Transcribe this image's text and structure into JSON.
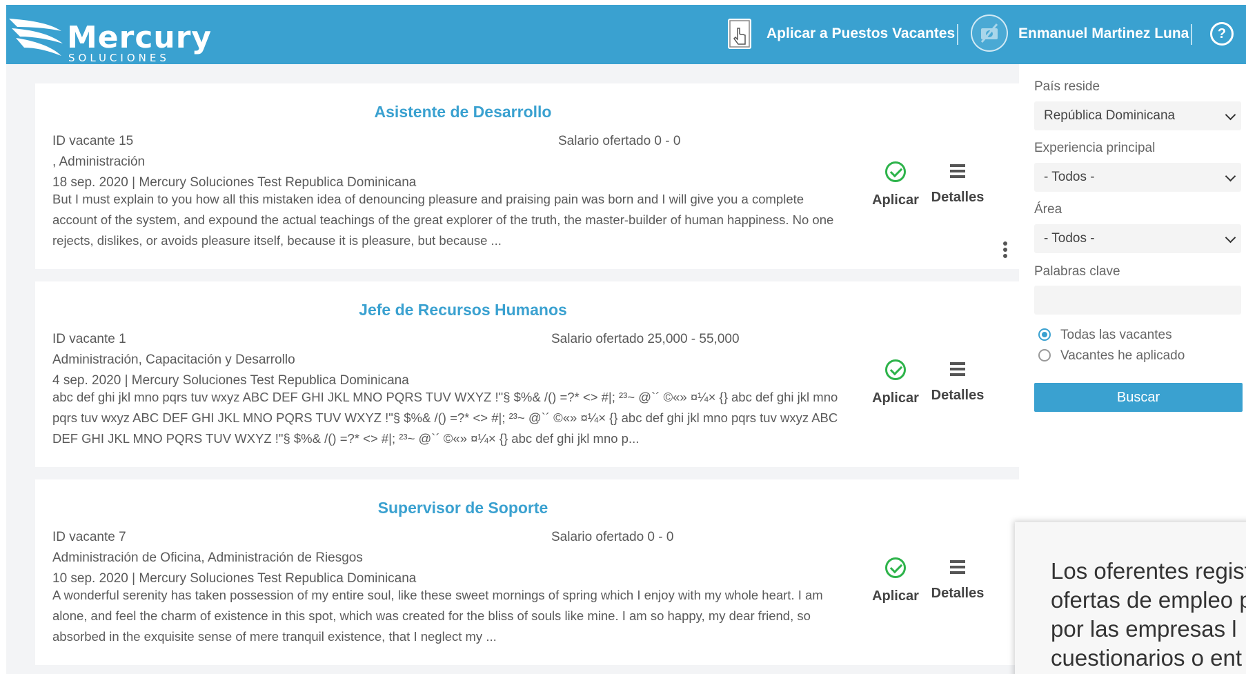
{
  "header": {
    "brand": "Mercury",
    "brand_sub": "SOLUCIONES",
    "apply_link": "Aplicar a Puestos Vacantes",
    "user_name": "Enmanuel Martinez Luna",
    "help_symbol": "?",
    "colors": {
      "primary": "#3aa1d0",
      "success": "#2db34a"
    }
  },
  "jobs": [
    {
      "title": "Asistente de Desarrollo",
      "id_text": "ID vacante  15",
      "salary_text": "Salario ofertado   0 - 0",
      "areas": ", Administración",
      "meta": "18 sep. 2020 | Mercury Soluciones Test Republica Dominicana",
      "description": "But I must explain to you how all this mistaken idea of denouncing pleasure and praising pain was born and I will give you a complete account of the system, and expound the actual teachings of the great explorer of the truth, the master-builder of human happiness. No one rejects, dislikes, or avoids pleasure itself, because it is pleasure, but because ...",
      "apply_label": "Aplicar",
      "details_label": "Detalles"
    },
    {
      "title": "Jefe de Recursos Humanos",
      "id_text": "ID vacante  1",
      "salary_text": "Salario ofertado   25,000 - 55,000",
      "areas": "Administración, Capacitación y Desarrollo",
      "meta": "4 sep. 2020 | Mercury Soluciones Test Republica Dominicana",
      "description": "abc def ghi jkl mno pqrs tuv wxyz ABC DEF GHI JKL MNO PQRS TUV WXYZ !\"§ $%& /() =?* <> #|; ²³~ @`´ ©«» ¤¼× {} abc def ghi jkl mno pqrs tuv wxyz ABC DEF GHI JKL MNO PQRS TUV WXYZ !\"§ $%& /() =?* <> #|; ²³~ @`´ ©«» ¤¼× {} abc def ghi jkl mno pqrs tuv wxyz ABC DEF GHI JKL MNO PQRS TUV WXYZ !\"§ $%& /() =?* <> #|; ²³~ @`´ ©«» ¤¼× {} abc def ghi jkl mno p...",
      "apply_label": "Aplicar",
      "details_label": "Detalles"
    },
    {
      "title": "Supervisor de Soporte",
      "id_text": "ID vacante  7",
      "salary_text": "Salario ofertado   0 - 0",
      "areas": "Administración de Oficina, Administración de Riesgos",
      "meta": "10 sep. 2020 | Mercury Soluciones Test Republica Dominicana",
      "description": "A wonderful serenity has taken possession of my entire soul, like these sweet mornings of spring which I enjoy with my whole heart. I am alone, and feel the charm of existence in this spot, which was created for the bliss of souls like mine. I am so happy, my dear friend, so absorbed in the exquisite sense of mere tranquil existence, that I neglect my ...",
      "apply_label": "Aplicar",
      "details_label": "Detalles"
    }
  ],
  "filters": {
    "country_label": "País reside",
    "country_value": "República Dominicana",
    "experience_label": "Experiencia principal",
    "experience_value": "- Todos -",
    "area_label": "Área",
    "area_value": "- Todos -",
    "keywords_label": "Palabras clave",
    "keywords_value": "",
    "radio_all": "Todas las vacantes",
    "radio_applied": "Vacantes he aplicado",
    "search_button": "Buscar"
  },
  "popup": {
    "lines": [
      "Los oferentes regist",
      "ofertas de empleo p",
      "por las empresas l",
      "cuestionarios o ent"
    ]
  }
}
